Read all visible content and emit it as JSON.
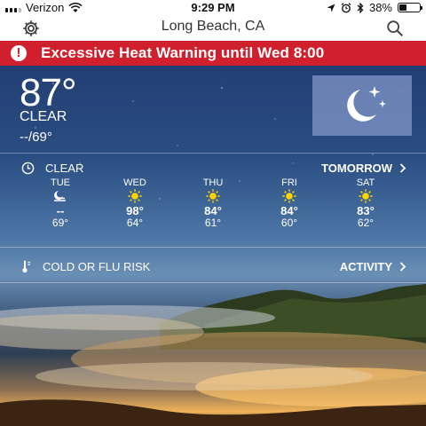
{
  "status_bar": {
    "carrier": "Verizon",
    "time": "9:29 PM",
    "battery": "38%",
    "battery_level": 0.38
  },
  "nav": {
    "title": "Long Beach, CA",
    "left_icon": "gear-icon",
    "right_icon": "search-icon"
  },
  "alert": {
    "text": "Excessive Heat Warning until Wed 8:00",
    "color": "#d0202e"
  },
  "current": {
    "temperature": "87°",
    "condition": "CLEAR",
    "hi_lo": "--/69°",
    "icon": "moon-stars-icon"
  },
  "forecast": {
    "header_left": "CLEAR",
    "header_right": "TOMORROW",
    "days": [
      {
        "name": "TUE",
        "icon": "moon-cloud-icon",
        "hi": "--",
        "lo": "69°"
      },
      {
        "name": "WED",
        "icon": "sun-icon",
        "hi": "98°",
        "lo": "64°"
      },
      {
        "name": "THU",
        "icon": "sun-icon",
        "hi": "84°",
        "lo": "61°"
      },
      {
        "name": "FRI",
        "icon": "sun-icon",
        "hi": "84°",
        "lo": "60°"
      },
      {
        "name": "SAT",
        "icon": "sun-icon",
        "hi": "83°",
        "lo": "62°"
      }
    ]
  },
  "health": {
    "left": "COLD OR FLU RISK",
    "right": "ACTIVITY"
  }
}
